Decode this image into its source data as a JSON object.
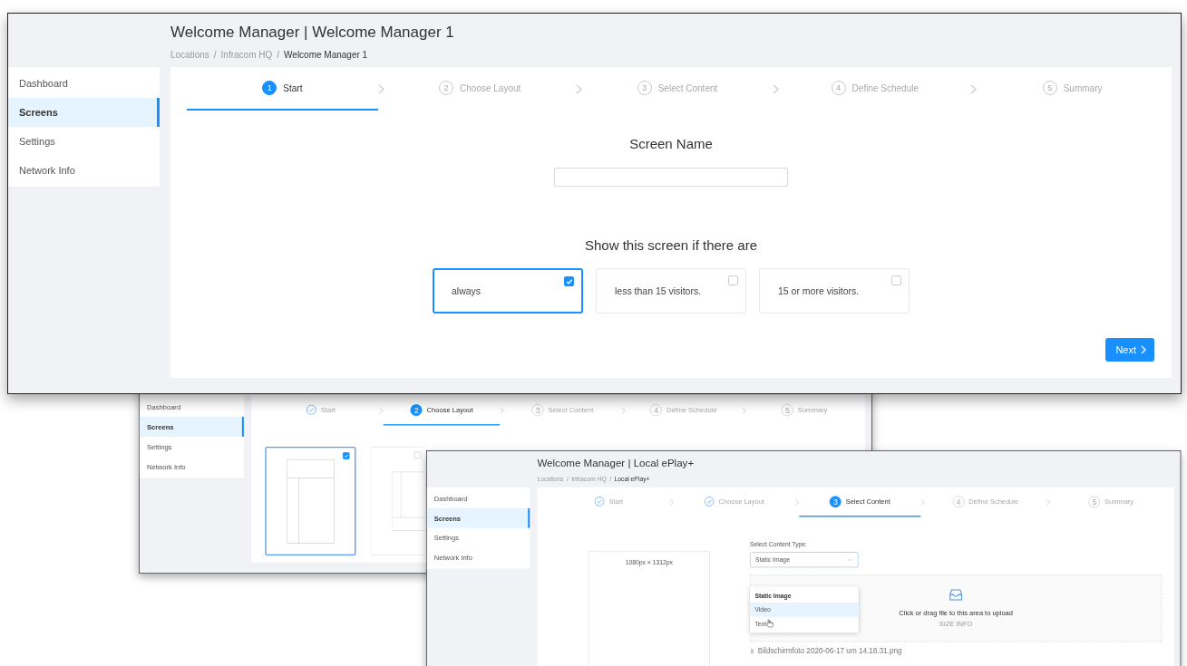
{
  "windows": [
    {
      "kind": "name_screen",
      "title": "Welcome Manager | Welcome Manager 1",
      "breadcrumb": {
        "separator": "/",
        "items": [
          {
            "label": "Locations",
            "current": false
          },
          {
            "label": "Infracom HQ",
            "current": false
          },
          {
            "label": "Welcome Manager 1",
            "current": true
          }
        ]
      },
      "sidebar": [
        {
          "label": "Dashboard",
          "selected": false
        },
        {
          "label": "Screens",
          "selected": true
        },
        {
          "label": "Settings",
          "selected": false
        },
        {
          "label": "Network Info",
          "selected": false
        }
      ],
      "steps": [
        {
          "number": "1",
          "label": "Start",
          "selected": true,
          "done": false
        },
        {
          "number": "2",
          "label": "Choose Layout",
          "selected": false,
          "done": false
        },
        {
          "number": "3",
          "label": "Select Content",
          "selected": false,
          "done": false
        },
        {
          "number": "4",
          "label": "Define Schedule",
          "selected": false,
          "done": false
        },
        {
          "number": "5",
          "label": "Summary",
          "selected": false,
          "done": false
        }
      ],
      "form": {
        "name_label": "Screen Name",
        "condition_label": "Show this screen if there are",
        "options": [
          {
            "label": "always",
            "selected": true
          },
          {
            "label": "less than 15 visitors.",
            "selected": false
          },
          {
            "label": "15 or more visitors.",
            "selected": false
          }
        ],
        "next_button": "Next"
      }
    },
    {
      "kind": "choose_layout",
      "sidebar": [
        {
          "label": "Dashboard",
          "selected": false
        },
        {
          "label": "Screens",
          "selected": true
        },
        {
          "label": "Settings",
          "selected": false
        },
        {
          "label": "Network Info",
          "selected": false
        }
      ],
      "steps": [
        {
          "label": "Start",
          "selected": false,
          "done": true
        },
        {
          "number": "2",
          "label": "Choose Layout",
          "selected": true,
          "done": false
        },
        {
          "number": "3",
          "label": "Select Content",
          "selected": false,
          "done": false
        },
        {
          "number": "4",
          "label": "Define Schedule",
          "selected": false,
          "done": false
        },
        {
          "number": "5",
          "label": "Summary",
          "selected": false,
          "done": false
        }
      ],
      "layouts": [
        {
          "kind": "header_sidebar",
          "selected": true
        },
        {
          "kind": "sidebar_footer",
          "selected": false
        }
      ]
    },
    {
      "kind": "select_content",
      "title": "Welcome Manager | Local ePlay+",
      "breadcrumb": {
        "separator": "/",
        "items": [
          {
            "label": "Locations",
            "current": false
          },
          {
            "label": "Infracom HQ",
            "current": false
          },
          {
            "label": "Local ePlay+",
            "current": true
          }
        ]
      },
      "sidebar": [
        {
          "label": "Dashboard",
          "selected": false
        },
        {
          "label": "Screens",
          "selected": true
        },
        {
          "label": "Settings",
          "selected": false
        },
        {
          "label": "Network Info",
          "selected": false
        }
      ],
      "steps": [
        {
          "label": "Start",
          "selected": false,
          "done": true
        },
        {
          "label": "Choose Layout",
          "selected": false,
          "done": true
        },
        {
          "number": "3",
          "label": "Select Content",
          "selected": true,
          "done": false
        },
        {
          "number": "4",
          "label": "Define Schedule",
          "selected": false,
          "done": false
        },
        {
          "number": "5",
          "label": "Summary",
          "selected": false,
          "done": false
        }
      ],
      "preview_size": "1080px × 1312px",
      "content_type_label": "Select Content Type:",
      "content_type_value": "Static Image",
      "content_type_options": [
        {
          "label": "Static Image",
          "selected": true,
          "hovered": false
        },
        {
          "label": "Video",
          "selected": false,
          "hovered": true
        },
        {
          "label": "Text",
          "selected": false,
          "hovered": false
        }
      ],
      "upload_text": "Click or drag file to this area to upload",
      "upload_hint": "SIZE INFO",
      "file_name": "Bildschirmfoto 2020-06-17 um 14.18.31.png"
    }
  ]
}
